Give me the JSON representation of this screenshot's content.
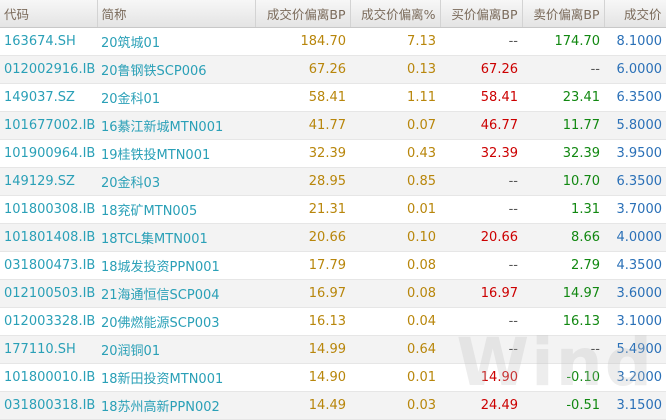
{
  "headers": [
    "代码",
    "简称",
    "成交价偏离BP",
    "成交价偏离%",
    "买价偏离BP",
    "卖价偏离BP",
    "成交价"
  ],
  "rows": [
    {
      "code": "163674.SH",
      "name": "20筑城01",
      "bp": "184.70",
      "pct": "7.13",
      "buy": "--",
      "sell": "174.70",
      "price": "8.1000"
    },
    {
      "code": "012002916.IB",
      "name": "20鲁钢铁SCP006",
      "bp": "67.26",
      "pct": "0.13",
      "buy": "67.26",
      "sell": "--",
      "price": "6.0000"
    },
    {
      "code": "149037.SZ",
      "name": "20金科01",
      "bp": "58.41",
      "pct": "1.11",
      "buy": "58.41",
      "sell": "23.41",
      "price": "6.3500"
    },
    {
      "code": "101677002.IB",
      "name": "16綦江新城MTN001",
      "bp": "41.77",
      "pct": "0.07",
      "buy": "46.77",
      "sell": "11.77",
      "price": "5.8000"
    },
    {
      "code": "101900964.IB",
      "name": "19桂铁投MTN001",
      "bp": "32.39",
      "pct": "0.43",
      "buy": "32.39",
      "sell": "32.39",
      "price": "3.9500"
    },
    {
      "code": "149129.SZ",
      "name": "20金科03",
      "bp": "28.95",
      "pct": "0.85",
      "buy": "--",
      "sell": "10.70",
      "price": "6.3500"
    },
    {
      "code": "101800308.IB",
      "name": "18兖矿MTN005",
      "bp": "21.31",
      "pct": "0.01",
      "buy": "--",
      "sell": "1.31",
      "price": "3.7000"
    },
    {
      "code": "101801408.IB",
      "name": "18TCL集MTN001",
      "bp": "20.66",
      "pct": "0.10",
      "buy": "20.66",
      "sell": "8.66",
      "price": "4.0000"
    },
    {
      "code": "031800473.IB",
      "name": "18城发投资PPN001",
      "bp": "17.79",
      "pct": "0.08",
      "buy": "--",
      "sell": "2.79",
      "price": "4.3500"
    },
    {
      "code": "012100503.IB",
      "name": "21海通恒信SCP004",
      "bp": "16.97",
      "pct": "0.08",
      "buy": "16.97",
      "sell": "14.97",
      "price": "3.6000"
    },
    {
      "code": "012003328.IB",
      "name": "20佛燃能源SCP003",
      "bp": "16.13",
      "pct": "0.04",
      "buy": "--",
      "sell": "16.13",
      "price": "3.1000"
    },
    {
      "code": "177110.SH",
      "name": "20润铜01",
      "bp": "14.99",
      "pct": "0.64",
      "buy": "--",
      "sell": "--",
      "price": "5.4900"
    },
    {
      "code": "101800010.IB",
      "name": "18新田投资MTN001",
      "bp": "14.90",
      "pct": "0.01",
      "buy": "14.90",
      "sell": "-0.10",
      "price": "3.2000"
    },
    {
      "code": "031800318.IB",
      "name": "18苏州高新PPN002",
      "bp": "14.49",
      "pct": "0.03",
      "buy": "24.49",
      "sell": "-0.51",
      "price": "3.1500"
    }
  ],
  "watermark": "Wind"
}
